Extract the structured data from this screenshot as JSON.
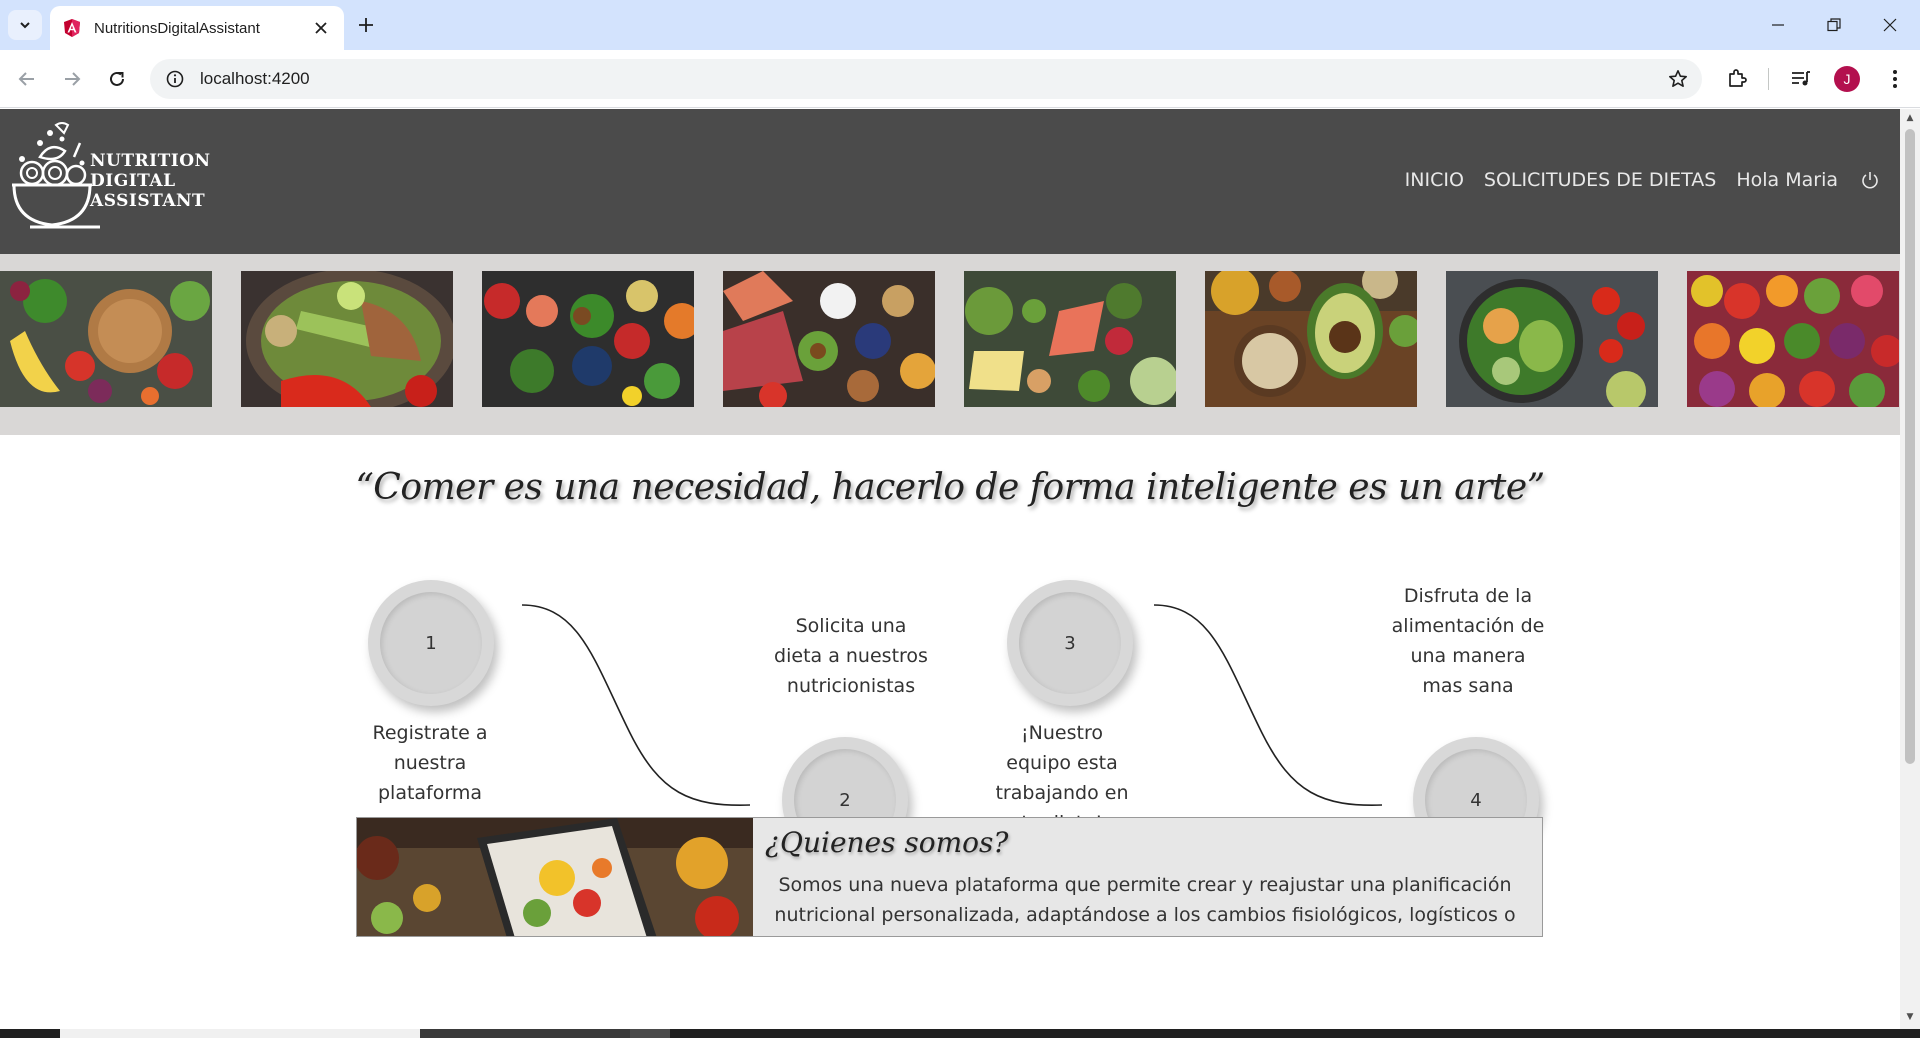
{
  "browser": {
    "tab_title": "NutritionsDigitalAssistant",
    "url": "localhost:4200",
    "profile_initial": "J"
  },
  "header": {
    "logo_lines": [
      "NUTRITION",
      "DIGITAL",
      "ASSISTANT"
    ],
    "nav": {
      "inicio": "INICIO",
      "solicitudes": "SOLICITUDES DE DIETAS",
      "greeting": "Hola Maria"
    }
  },
  "quote": "“Comer es una necesidad, hacerlo de forma inteligente es un arte”",
  "steps": [
    {
      "number": "1",
      "line1": "Registrate a",
      "line2": "nuestra",
      "line3": "plataforma",
      "line4": ""
    },
    {
      "number": "2",
      "line1": "Solicita una",
      "line2": "dieta a nuestros",
      "line3": "nutricionistas",
      "line4": ""
    },
    {
      "number": "3",
      "line1": "¡Nuestro",
      "line2": "equipo esta",
      "line3": "trabajando en",
      "line4": "tu dieta!"
    },
    {
      "number": "4",
      "line1": "Disfruta de la",
      "line2": "alimentación de",
      "line3": "una manera",
      "line4": "mas sana"
    }
  ],
  "about": {
    "title": "¿Quienes somos?",
    "body_line1": "Somos una nueva plataforma que permite crear y reajustar una planificación",
    "body_line2": "nutricional personalizada, adaptándose a los cambios fisiológicos, logísticos o de"
  },
  "colors": {
    "header_bg": "#4b4b4b",
    "gallery_bg": "#d9d7d6",
    "tabstrip_bg": "#d3e3fd",
    "avatar_bg": "#b3104e"
  },
  "icons": {
    "back": "arrow-left-icon",
    "forward": "arrow-right-icon",
    "reload": "reload-icon",
    "site_info": "site-info-icon",
    "bookmark": "star-icon",
    "extensions": "puzzle-icon",
    "media": "media-control-icon",
    "menu": "kebab-menu-icon",
    "logout": "power-icon"
  }
}
